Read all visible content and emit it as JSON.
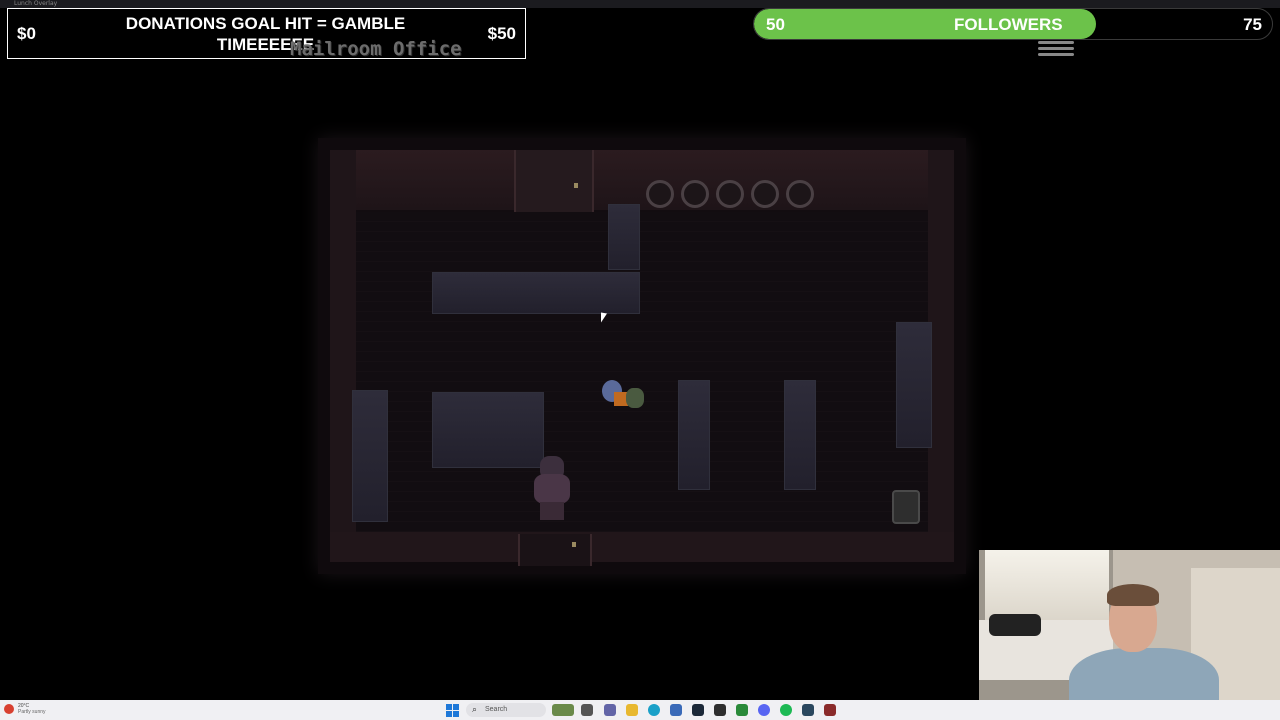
{
  "window": {
    "title": "Lunch Overlay"
  },
  "overlay": {
    "donation": {
      "current": "$0",
      "text": "DONATIONS GOAL HIT = GAMBLE TIMEEEEEE",
      "goal": "$50"
    },
    "followers": {
      "start": "50",
      "label": "FOLLOWERS",
      "end": "75",
      "progress": 0.66,
      "fill_color": "#6cc24a"
    }
  },
  "game": {
    "room_title": "Mailroom Office"
  },
  "taskbar": {
    "weather_temp": "20°C",
    "weather_desc": "Partly sunny",
    "search_placeholder": "Search",
    "apps": [
      "file-explorer-icon",
      "teams-icon",
      "folder-icon",
      "edge-icon",
      "store-icon",
      "steam-icon",
      "xbox-icon",
      "obs-icon",
      "discord-icon",
      "spotify-icon",
      "steam-alt-icon",
      "game-icon"
    ]
  }
}
